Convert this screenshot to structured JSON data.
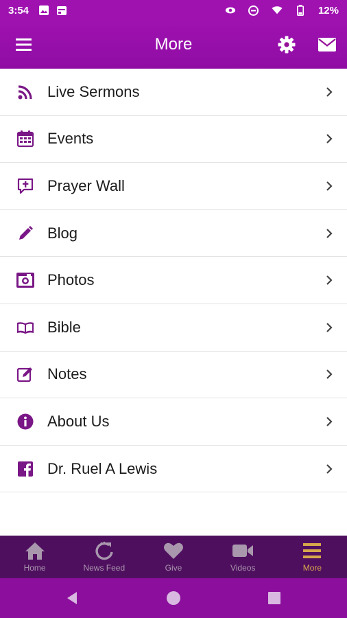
{
  "status": {
    "time": "3:54",
    "battery": "12%"
  },
  "header": {
    "title": "More",
    "icons": [
      "menu-icon",
      "gear-icon",
      "mail-icon"
    ]
  },
  "menu": {
    "items": [
      {
        "label": "Live Sermons",
        "icon": "rss-icon"
      },
      {
        "label": "Events",
        "icon": "calendar-icon"
      },
      {
        "label": "Prayer Wall",
        "icon": "prayer-icon"
      },
      {
        "label": "Blog",
        "icon": "pencil-icon"
      },
      {
        "label": "Photos",
        "icon": "camera-icon"
      },
      {
        "label": "Bible",
        "icon": "book-icon"
      },
      {
        "label": "Notes",
        "icon": "notes-icon"
      },
      {
        "label": "About Us",
        "icon": "info-icon"
      },
      {
        "label": "Dr. Ruel A Lewis",
        "icon": "facebook-icon"
      }
    ]
  },
  "tabs": {
    "items": [
      {
        "label": "Home",
        "icon": "home-icon"
      },
      {
        "label": "News Feed",
        "icon": "refresh-icon"
      },
      {
        "label": "Give",
        "icon": "heart-icon"
      },
      {
        "label": "Videos",
        "icon": "video-icon"
      },
      {
        "label": "More",
        "icon": "menu-icon",
        "active": true
      }
    ]
  },
  "colors": {
    "primary": "#9f12b0",
    "icon_purple": "#7a1786",
    "tab_bar": "#4f0f5f",
    "tab_active": "#d6a74b",
    "tab_inactive": "#a998ad"
  }
}
